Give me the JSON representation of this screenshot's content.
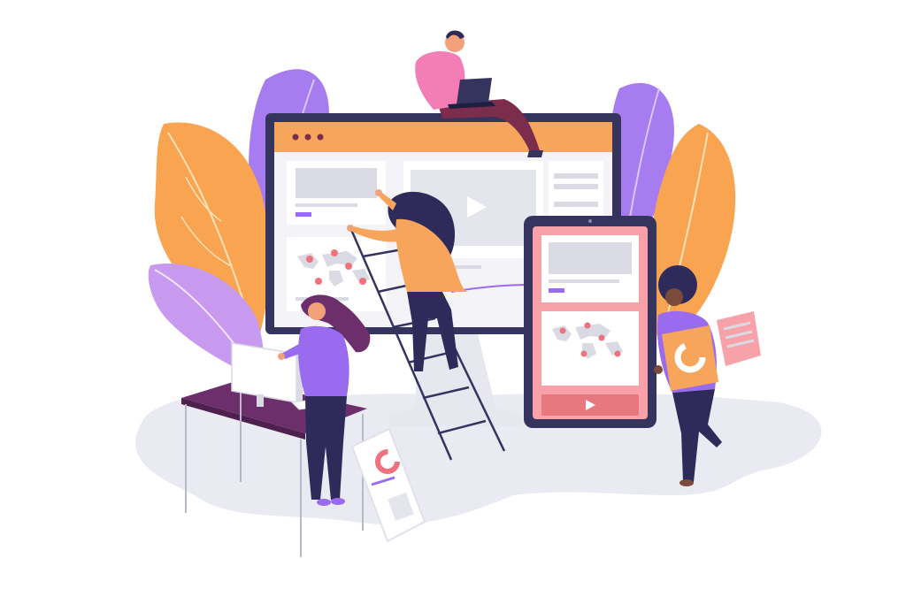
{
  "illustration": {
    "palette": {
      "background": "#ffffff",
      "floor": "#E9EAF2",
      "leaf_orange_light": "#FFC36B",
      "leaf_orange_dark": "#F58A4B",
      "leaf_purple_light": "#C89BF5",
      "leaf_purple_dark": "#8C63E8",
      "monitor_frame": "#34345E",
      "browser_bar": "#F7A55B",
      "screen_bg": "#F4F4F8",
      "placeholder": "#D9DAE3",
      "accent_purple": "#9B6BEF",
      "map_pin": "#F0727E",
      "tablet_frame": "#34345E",
      "tablet_pink": "#F8A1A8",
      "tablet_play": "#E8777F",
      "desk": "#6D2F6C",
      "person_pink": "#F37EB5",
      "person_orange": "#F7A55B",
      "person_purple": "#9B6BEF",
      "hair_dark": "#2E2B5A",
      "pants_dark": "#2E2B5A",
      "skin": "#F2A27B",
      "skin_dark": "#7A4A3A"
    },
    "icons": [
      "play-icon",
      "map-pin-icon",
      "donut-chart-icon",
      "laptop-icon"
    ]
  }
}
